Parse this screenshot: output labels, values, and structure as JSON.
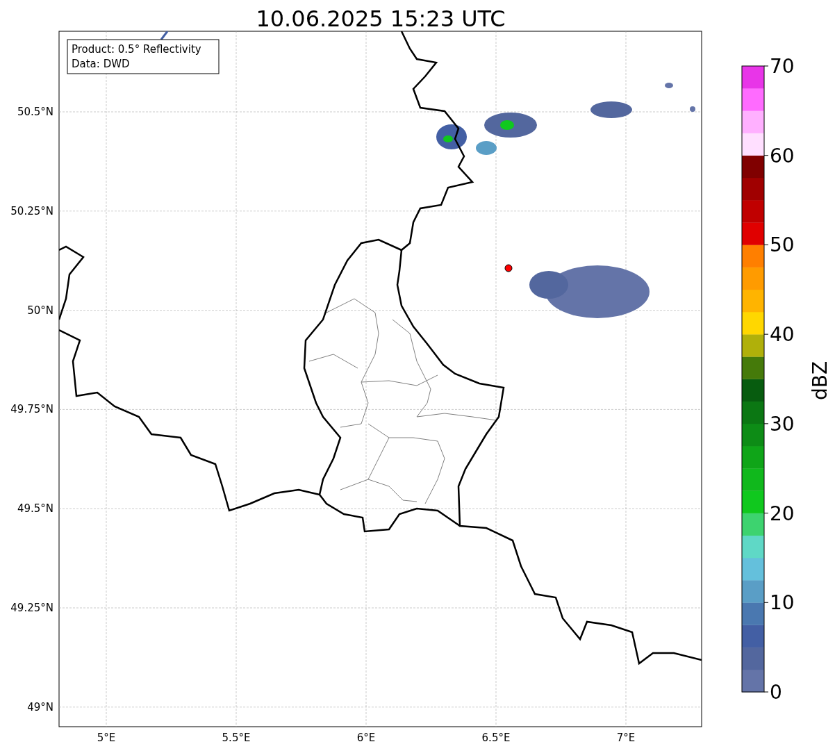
{
  "title": "10.06.2025 15:23 UTC",
  "legend": {
    "lines": [
      "Product: 0.5° Reflectivity",
      "Data: DWD"
    ]
  },
  "axes": {
    "lon_ticks": [
      "5°E",
      "5.5°E",
      "6°E",
      "6.5°E",
      "7°E"
    ],
    "lat_ticks": [
      "50.5°N",
      "50.25°N",
      "50°N",
      "49.75°N",
      "49.5°N",
      "49.25°N",
      "49°N"
    ]
  },
  "colorbar": {
    "label": "dBZ",
    "ticks": [
      "70",
      "60",
      "50",
      "40",
      "30",
      "20",
      "10",
      "0"
    ],
    "bins": [
      {
        "color": "#6474a8"
      },
      {
        "color": "#53679e"
      },
      {
        "color": "#435fa4"
      },
      {
        "color": "#4a78b0"
      },
      {
        "color": "#5a9ec6"
      },
      {
        "color": "#64c0dc"
      },
      {
        "color": "#5fd8c6"
      },
      {
        "color": "#3dd36f"
      },
      {
        "color": "#10c81e"
      },
      {
        "color": "#10b81c"
      },
      {
        "color": "#0fa518"
      },
      {
        "color": "#0d8c16"
      },
      {
        "color": "#0b7713"
      },
      {
        "color": "#075c0f"
      },
      {
        "color": "#457a0a"
      },
      {
        "color": "#b0b00a"
      },
      {
        "color": "#ffd700"
      },
      {
        "color": "#ffb400"
      },
      {
        "color": "#ff9b00"
      },
      {
        "color": "#ff7f00"
      },
      {
        "color": "#e00000"
      },
      {
        "color": "#c00000"
      },
      {
        "color": "#a00000"
      },
      {
        "color": "#800000"
      },
      {
        "color": "#ffdfff"
      },
      {
        "color": "#ffb0ff"
      },
      {
        "color": "#ff6bff"
      },
      {
        "color": "#e835e8"
      }
    ]
  }
}
